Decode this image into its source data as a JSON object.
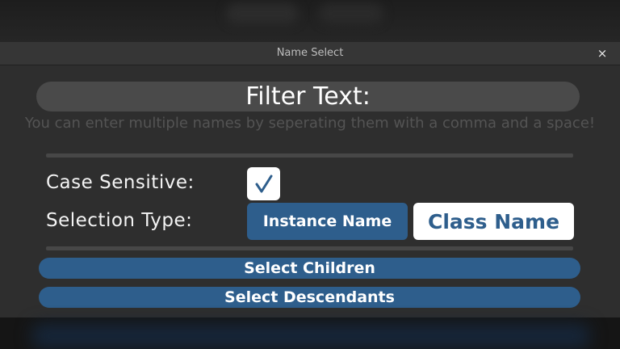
{
  "window": {
    "title": "Name Select",
    "close_icon": "×"
  },
  "filter": {
    "placeholder": "Filter Text:",
    "hint": "You can enter multiple names by seperating them with a comma and a space!"
  },
  "case_sensitive": {
    "label": "Case Sensitive:",
    "checked": true,
    "check_glyph": "✓"
  },
  "selection_type": {
    "label": "Selection Type:",
    "options": [
      "Instance Name",
      "Class Name"
    ],
    "selected": "Class Name"
  },
  "actions": {
    "select_children": "Select Children",
    "select_descendants": "Select Descendants"
  },
  "colors": {
    "accent": "#2e5e8c",
    "panel": "#2e2e2e",
    "titlebar": "#363636",
    "input": "#4a4a4a"
  }
}
